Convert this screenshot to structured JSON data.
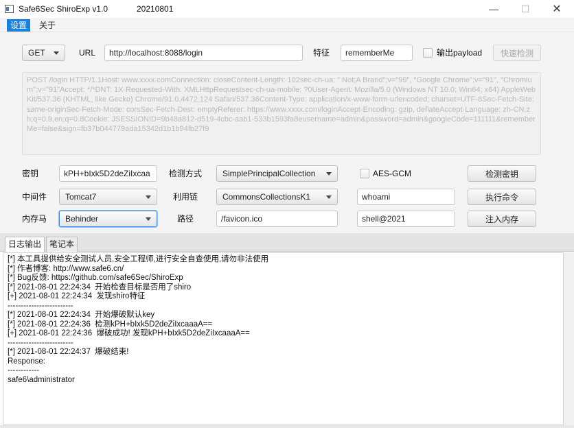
{
  "window": {
    "title": "Safe6Sec ShiroExp v1.0",
    "version_date": "20210801",
    "minimize_glyph": "—",
    "maximize_glyph": "☐",
    "close_glyph": "✕"
  },
  "menu": {
    "items": [
      {
        "label": "设置",
        "active": true
      },
      {
        "label": "关于",
        "active": false
      }
    ]
  },
  "request": {
    "method": "GET",
    "url_label": "URL",
    "url_value": "http://localhost:8088/login",
    "feature_label": "特征",
    "feature_value": "rememberMe",
    "output_payload_label": "输出payload",
    "quick_detect_label": "快速检测",
    "raw_request": "POST /login HTTP/1.1Host: www.xxxx.comConnection: closeContent-Length: 102sec-ch-ua: \" Not;A Brand\";v=\"99\", \"Google Chrome\";v=\"91\", \"Chromium\";v=\"91\"Accept: */*DNT: 1X-Requested-With: XMLHttpRequestsec-ch-ua-mobile: ?0User-Agent: Mozilla/5.0 (Windows NT 10.0; Win64; x64) AppleWebKit/537.36 (KHTML, like Gecko) Chrome/91.0.4472.124 Safari/537.36Content-Type: application/x-www-form-urlencoded; charset=UTF-8Sec-Fetch-Site: same-originSec-Fetch-Mode: corsSec-Fetch-Dest: emptyReferer: https://www.xxxx.com/loginAccept-Encoding: gzip, deflateAccept-Language: zh-CN,zh;q=0.9,en;q=0.8Cookie: JSESSIONID=9b48a812-d519-4cbc-aab1-533b1593fa8eusername=admin&password=admin&googleCode=111111&rememberMe=false&sign=fb37b044779ada15342d1b1b94fb27f9"
  },
  "key_row": {
    "key_label": "密钥",
    "key_value": "kPH+bIxk5D2deZiIxcaa",
    "detect_method_label": "检测方式",
    "detect_method_value": "SimplePrincipalCollection",
    "aes_gcm_label": "AES-GCM",
    "detect_key_button": "检测密钥"
  },
  "exec_row": {
    "middleware_label": "中间件",
    "middleware_value": "Tomcat7",
    "chain_label": "利用链",
    "chain_value": "CommonsCollectionsK1",
    "command_value": "whoami",
    "exec_button": "执行命令"
  },
  "memshell_row": {
    "memshell_label": "内存马",
    "memshell_value": "Behinder",
    "path_label": "路径",
    "path_value": "/favicon.ico",
    "password_value": "shell@2021",
    "inject_button": "注入内存"
  },
  "tabs": [
    {
      "label": "日志输出",
      "active": true
    },
    {
      "label": "笔记本",
      "active": false
    }
  ],
  "log": {
    "text": "[*] 本工具提供给安全测试人员,安全工程师,进行安全自查使用,请勿非法使用\n[*] 作者博客: http://www.safe6.cn/\n[*] Bug反馈: https://github.com/safe6Sec/ShiroExp\n[*] 2021-08-01 22:24:34  开始检查目标是否用了shiro\n[+] 2021-08-01 22:24:34  发现shiro特征\n-------------------------\n[*] 2021-08-01 22:24:34  开始爆破默认key\n[*] 2021-08-01 22:24:36  检测kPH+bIxk5D2deZiIxcaaaA==\n[+] 2021-08-01 22:24:36  爆破成功! 发现kPH+bIxk5D2deZiIxcaaaA==\n-------------------------\n[*] 2021-08-01 22:24:37  爆破结束!\nResponse:\n------------\nsafe6\\administrator"
  }
}
